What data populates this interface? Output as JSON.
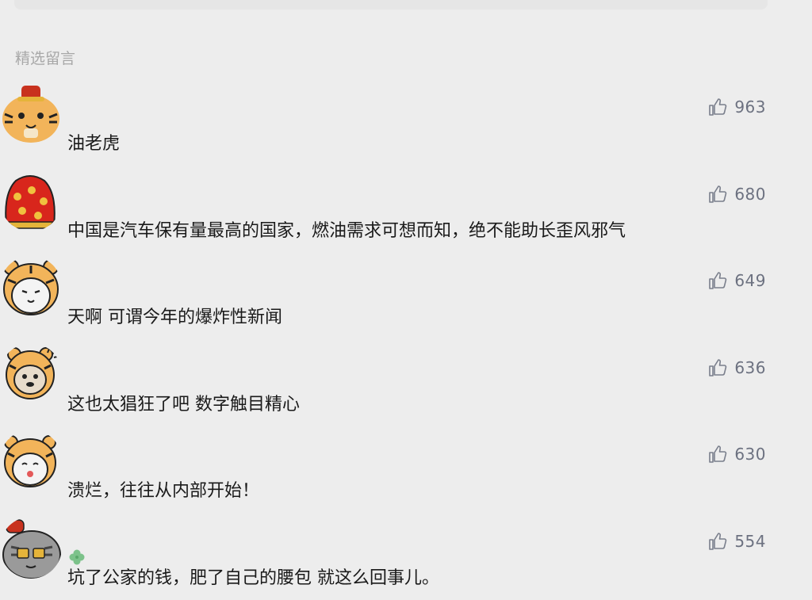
{
  "section": {
    "title": "精选留言"
  },
  "comments": [
    {
      "text": "油老虎",
      "likes": "963",
      "avatar_icon": "tiger-red-hat-avatar-icon"
    },
    {
      "text": "中国是汽车保有量最高的国家，燃油需求可想而知，绝不能助长歪风邪气",
      "likes": "680",
      "avatar_icon": "lucky-bag-avatar-icon"
    },
    {
      "text": "天啊 可谓今年的爆炸性新闻",
      "likes": "649",
      "avatar_icon": "tiger-hood-cat-avatar-icon"
    },
    {
      "text": "这也太猖狂了吧 数字触目精心",
      "likes": "636",
      "avatar_icon": "tiger-hood-dog-avatar-icon"
    },
    {
      "text": "溃烂，往往从内部开始！",
      "likes": "630",
      "avatar_icon": "tiger-hood-sad-cat-avatar-icon"
    },
    {
      "text": "坑了公家的钱，肥了自己的腰包 就这么回事儿。",
      "likes": "554",
      "avatar_icon": "money-cat-avatar-icon",
      "badge": "clover-icon"
    }
  ],
  "colors": {
    "background": "#ededed",
    "section_title": "#a8a8a8",
    "like": "#6c7180",
    "text": "#1a1a1a"
  }
}
